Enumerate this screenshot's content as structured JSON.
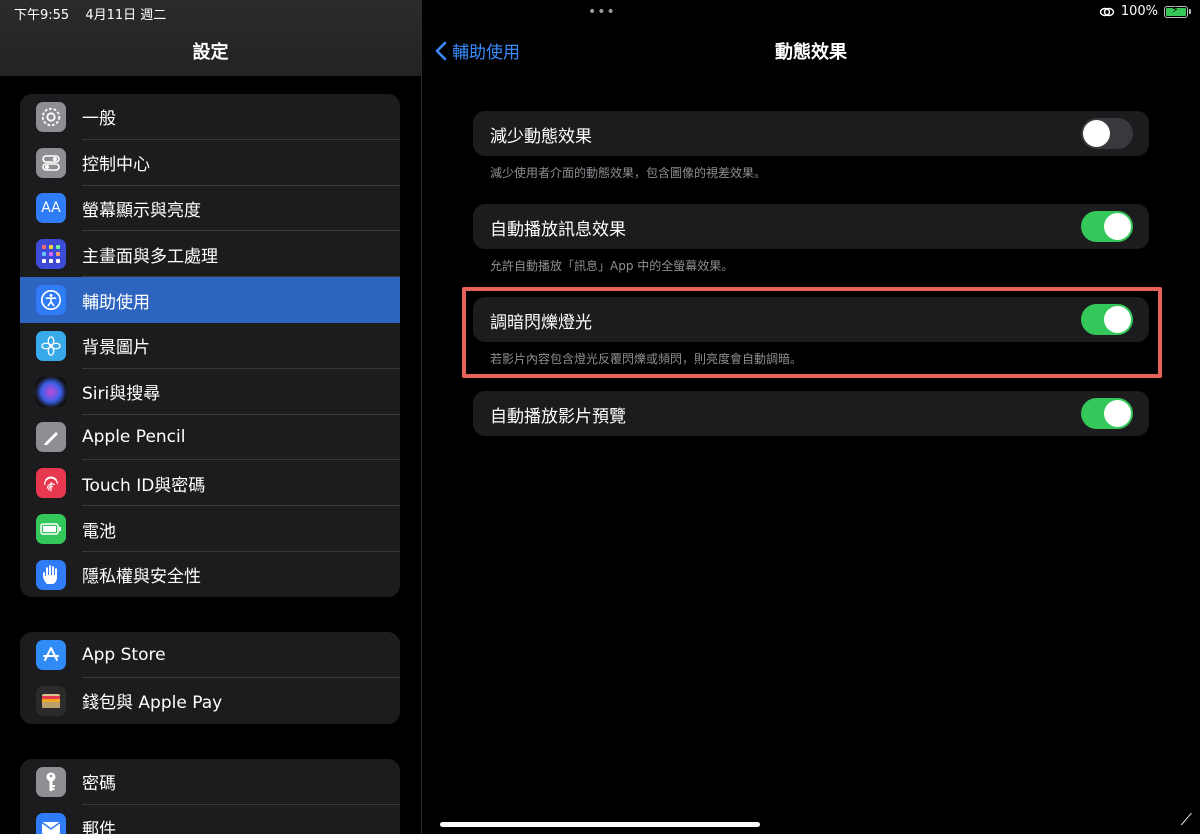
{
  "status_bar": {
    "time": "下午9:55",
    "date": "4月11日 週二",
    "battery_percent": "100%",
    "multitask_dots": "•••"
  },
  "sidebar": {
    "title": "設定",
    "groups": [
      {
        "items": [
          {
            "label": "一般",
            "icon": "gear-icon",
            "color": "#8e8e93"
          },
          {
            "label": "控制中心",
            "icon": "switches-icon",
            "color": "#8e8e93"
          },
          {
            "label": "螢幕顯示與亮度",
            "icon": "text-size-icon",
            "color": "#2f7cf6"
          },
          {
            "label": "主畫面與多工處理",
            "icon": "grid-icon",
            "color": "#3d4cd6"
          },
          {
            "label": "輔助使用",
            "icon": "accessibility-icon",
            "color": "#2f7cf6",
            "selected": true
          },
          {
            "label": "背景圖片",
            "icon": "flower-icon",
            "color": "#38a9e9"
          },
          {
            "label": "Siri與搜尋",
            "icon": "siri-icon",
            "color": "#1b1b1b"
          },
          {
            "label": "Apple Pencil",
            "icon": "pencil-icon",
            "color": "#8e8e93"
          },
          {
            "label": "Touch ID與密碼",
            "icon": "fingerprint-icon",
            "color": "#e8384f"
          },
          {
            "label": "電池",
            "icon": "battery-icon",
            "color": "#34c759"
          },
          {
            "label": "隱私權與安全性",
            "icon": "hand-icon",
            "color": "#2f7cf6"
          }
        ]
      },
      {
        "items": [
          {
            "label": "App Store",
            "icon": "app-store-icon",
            "color": "#2f8cf6"
          },
          {
            "label": "錢包與 Apple Pay",
            "icon": "wallet-icon",
            "color": "#2b2b2b"
          }
        ]
      },
      {
        "items": [
          {
            "label": "密碼",
            "icon": "key-icon",
            "color": "#8e8e93"
          },
          {
            "label": "郵件",
            "icon": "mail-icon",
            "color": "#2f7cf6"
          }
        ]
      }
    ]
  },
  "main": {
    "back_label": "輔助使用",
    "title": "動態效果",
    "settings": [
      {
        "label": "減少動態效果",
        "enabled": false,
        "footnote": "減少使用者介面的動態效果，包含圖像的視差效果。"
      },
      {
        "label": "自動播放訊息效果",
        "enabled": true,
        "footnote": "允許自動播放「訊息」App 中的全螢幕效果。"
      },
      {
        "label": "調暗閃爍燈光",
        "enabled": true,
        "footnote": "若影片內容包含燈光反覆閃爍或頻閃，則亮度會自動調暗。"
      },
      {
        "label": "自動播放影片預覽",
        "enabled": true,
        "footnote": ""
      }
    ],
    "highlight_color": "#e8635a"
  }
}
